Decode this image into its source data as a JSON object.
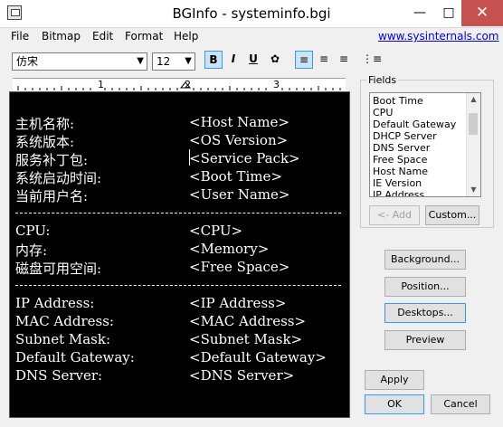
{
  "window": {
    "title": "BGInfo - systeminfo.bgi"
  },
  "menu": [
    "File",
    "Bitmap",
    "Edit",
    "Format",
    "Help"
  ],
  "link": "www.sysinternals.com",
  "toolbar": {
    "font": "仿宋",
    "size": "12",
    "bold": "B",
    "italic": "I",
    "underline": "U",
    "ruler_numbers": [
      "1",
      "2",
      "3"
    ]
  },
  "editor": {
    "rows": [
      {
        "label": "主机名称:",
        "value": "<Host Name>"
      },
      {
        "label": "系统版本:",
        "value": "<OS Version>"
      },
      {
        "label": "服务补丁包:",
        "value": "<Service Pack>"
      },
      {
        "label": "系统启动时间:",
        "value": "<Boot Time>"
      },
      {
        "label": "当前用户名:",
        "value": "<User Name>"
      },
      {
        "label": "CPU:",
        "value": "<CPU>"
      },
      {
        "label": "内存:",
        "value": "<Memory>"
      },
      {
        "label": "磁盘可用空间:",
        "value": "<Free Space>"
      },
      {
        "label": "IP Address:",
        "value": "<IP Address>"
      },
      {
        "label": "MAC Address:",
        "value": "<MAC Address>"
      },
      {
        "label": "Subnet Mask:",
        "value": "<Subnet Mask>"
      },
      {
        "label": "Default Gateway:",
        "value": "<Default Gateway>"
      },
      {
        "label": "DNS Server:",
        "value": "<DNS Server>"
      }
    ]
  },
  "fields": {
    "label": "Fields",
    "items": [
      "Boot Time",
      "CPU",
      "Default Gateway",
      "DHCP Server",
      "DNS Server",
      "Free Space",
      "Host Name",
      "IE Version",
      "IP Address"
    ],
    "add_label": "<- Add",
    "custom_label": "Custom..."
  },
  "buttons": {
    "background": "Background...",
    "position": "Position...",
    "desktops": "Desktops...",
    "preview": "Preview",
    "apply": "Apply",
    "ok": "OK",
    "cancel": "Cancel"
  }
}
